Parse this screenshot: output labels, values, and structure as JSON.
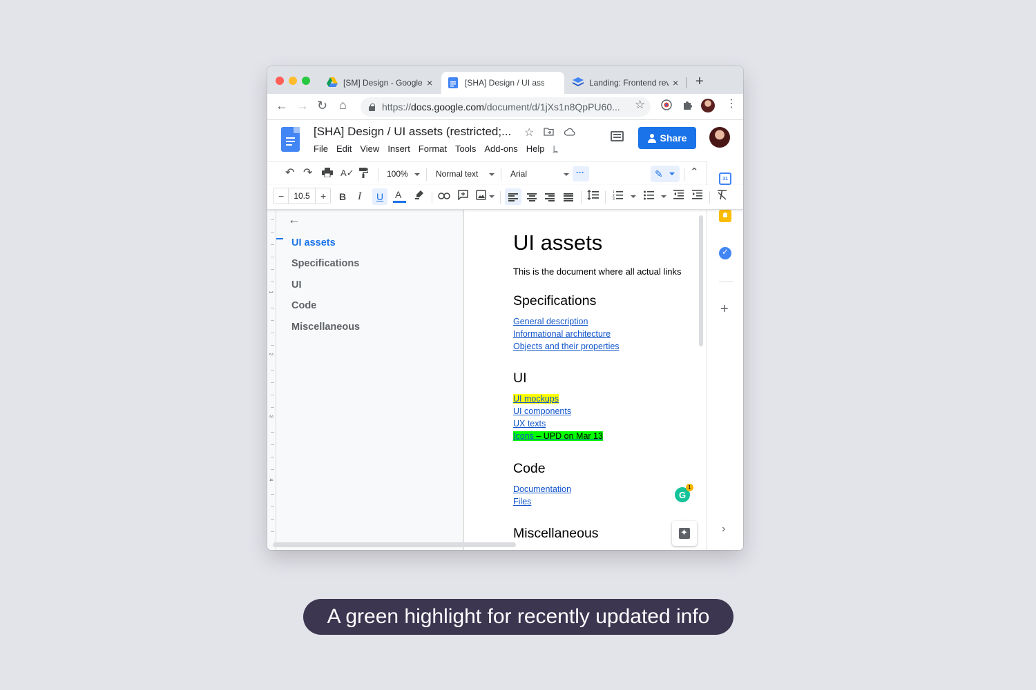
{
  "browser": {
    "tabs": [
      {
        "title": "[SM] Design - Google Drive",
        "icon": "google-drive-icon",
        "active": false
      },
      {
        "title": "[SHA] Design / UI assets",
        "icon": "google-docs-icon",
        "active": true
      },
      {
        "title": "Landing: Frontend review",
        "icon": "layers-icon",
        "active": false
      }
    ],
    "url_scheme": "https://",
    "url_host": "docs.google.com",
    "url_path": "/document/d/1jXs1n8QpPU60..."
  },
  "docs": {
    "title": "[SHA] Design / UI assets (restricted;...",
    "menus": [
      "File",
      "Edit",
      "View",
      "Insert",
      "Format",
      "Tools",
      "Add-ons",
      "Help"
    ],
    "menu_last": "L",
    "share_label": "Share",
    "accent_color": "#1a73e8"
  },
  "toolbar": {
    "zoom": "100%",
    "style": "Normal text",
    "font": "Arial",
    "font_size": "10.5",
    "more": "···"
  },
  "outline": {
    "items": [
      "UI assets",
      "Specifications",
      "UI",
      "Code",
      "Miscellaneous"
    ],
    "current": "UI assets",
    "ruler_numbers": [
      "1",
      "2",
      "3",
      "4"
    ]
  },
  "document": {
    "title": "UI assets",
    "subtitle": "This is the document where all actual links",
    "sections": [
      {
        "heading": "Specifications",
        "links": [
          "General description",
          "Informational architecture",
          "Objects and their properties"
        ]
      },
      {
        "heading": "UI",
        "links": [
          "UI mockups",
          "UI components",
          "UX texts",
          "Icons"
        ]
      },
      {
        "heading": "Code",
        "links": [
          "Documentation",
          "Files"
        ]
      },
      {
        "heading": "Miscellaneous",
        "links": []
      }
    ],
    "icons_note": " – UPD on Mar 13",
    "yellow_highlight": "#ffff00",
    "green_highlight": "#00ff00"
  },
  "side_panel": {
    "calendar_day": "31"
  },
  "grammarly": {
    "letter": "G",
    "count": "1"
  },
  "caption": "A green highlight for recently updated info"
}
